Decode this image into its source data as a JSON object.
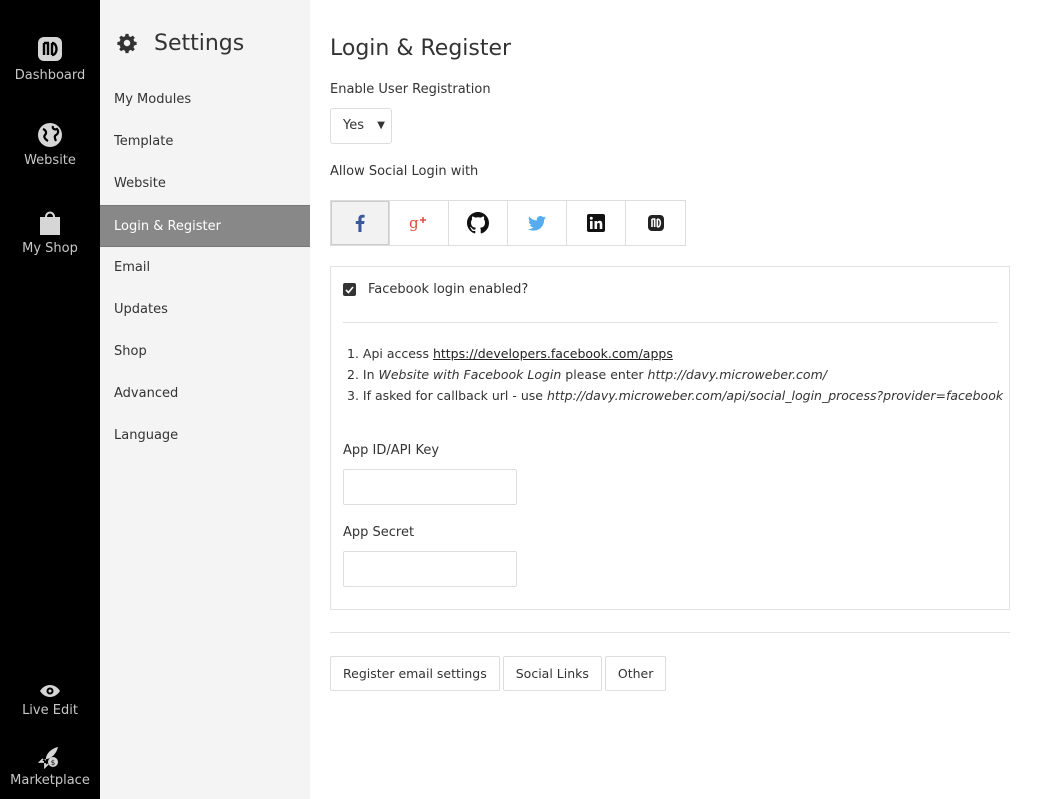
{
  "rail": {
    "dashboard": "Dashboard",
    "website": "Website",
    "my_shop": "My Shop",
    "live_edit": "Live Edit",
    "marketplace": "Marketplace"
  },
  "sidebar": {
    "title": "Settings",
    "items": [
      {
        "label": "My Modules"
      },
      {
        "label": "Template"
      },
      {
        "label": "Website"
      },
      {
        "label": "Login & Register",
        "active": true
      },
      {
        "label": "Email"
      },
      {
        "label": "Updates"
      },
      {
        "label": "Shop"
      },
      {
        "label": "Advanced"
      },
      {
        "label": "Language"
      }
    ]
  },
  "main": {
    "title": "Login & Register",
    "enable_registration_label": "Enable User Registration",
    "enable_registration_value": "Yes",
    "social_label": "Allow Social Login with",
    "social_tabs": [
      "facebook-icon",
      "google-plus-icon",
      "github-icon",
      "twitter-icon",
      "linkedin-icon",
      "microweber-icon"
    ],
    "panel": {
      "checkbox_label": "Facebook login enabled?",
      "step1_prefix": "1. Api access ",
      "step1_link": "https://developers.facebook.com/apps",
      "step2_prefix": "2. In ",
      "step2_em": "Website with Facebook Login",
      "step2_mid": " please enter ",
      "step2_url": "http://davy.microweber.com/",
      "step3_prefix": "3. If asked for callback url - use ",
      "step3_url": "http://davy.microweber.com/api/social_login_process?provider=facebook",
      "app_id_label": "App ID/API Key",
      "app_id_value": "",
      "app_secret_label": "App Secret",
      "app_secret_value": ""
    },
    "buttons": {
      "register_email": "Register email settings",
      "social_links": "Social Links",
      "other": "Other"
    }
  },
  "colors": {
    "rail_bg": "#000000",
    "sidebar_bg": "#f4f4f4",
    "active_item_bg": "#888888",
    "twitter": "#55acee",
    "google": "#dd4b39"
  }
}
